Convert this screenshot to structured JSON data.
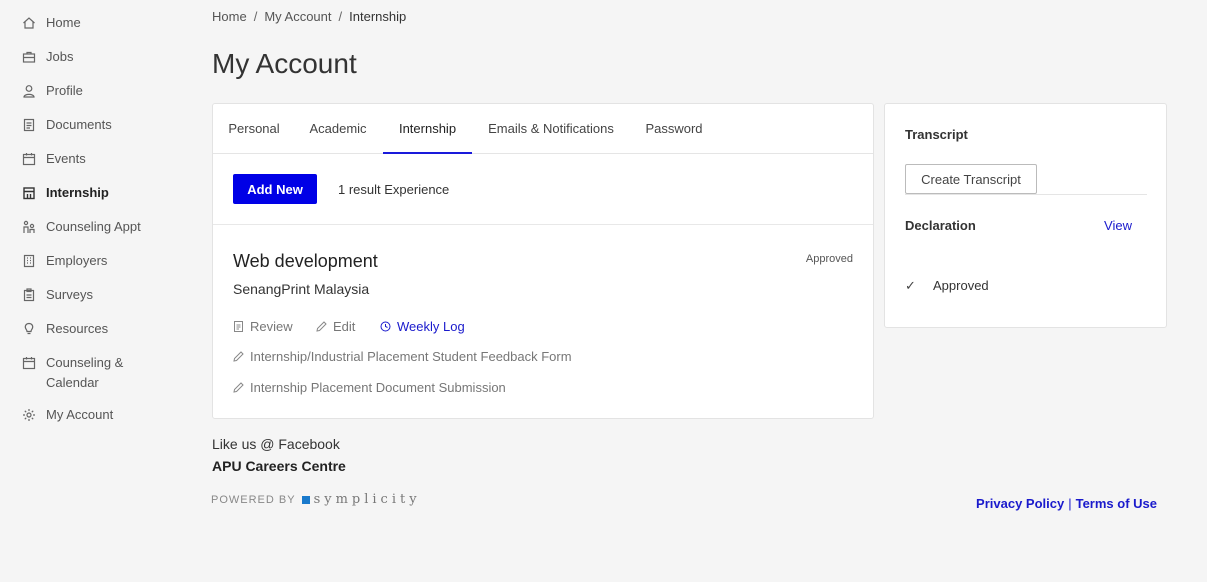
{
  "sidebar": {
    "items": [
      {
        "label": "Home",
        "icon": "home-icon"
      },
      {
        "label": "Jobs",
        "icon": "briefcase-icon"
      },
      {
        "label": "Profile",
        "icon": "user-icon"
      },
      {
        "label": "Documents",
        "icon": "document-icon"
      },
      {
        "label": "Events",
        "icon": "calendar-icon"
      },
      {
        "label": "Internship",
        "icon": "building-icon"
      },
      {
        "label": "Counseling Appt",
        "icon": "counseling-icon"
      },
      {
        "label": "Employers",
        "icon": "office-icon"
      },
      {
        "label": "Surveys",
        "icon": "clipboard-icon"
      },
      {
        "label": "Resources",
        "icon": "lightbulb-icon"
      },
      {
        "label": "Counseling & Calendar",
        "icon": "calendar-icon"
      },
      {
        "label": "My Account",
        "icon": "gear-icon"
      }
    ],
    "active": "Internship"
  },
  "breadcrumb": {
    "items": [
      "Home",
      "My Account",
      "Internship"
    ],
    "separator": "/"
  },
  "page": {
    "title": "My Account"
  },
  "tabs": {
    "items": [
      "Personal",
      "Academic",
      "Internship",
      "Emails & Notifications",
      "Password"
    ],
    "active": "Internship"
  },
  "main": {
    "add_button": "Add New",
    "result_text": "1 result Experience",
    "experience": {
      "title": "Web development",
      "company": "SenangPrint Malaysia",
      "status": "Approved",
      "actions": {
        "review": "Review",
        "edit": "Edit",
        "weekly_log": "Weekly Log",
        "feedback_form": "Internship/Industrial Placement Student Feedback Form",
        "doc_submission": "Internship Placement Document Submission"
      }
    }
  },
  "side": {
    "transcript_label": "Transcript",
    "create_button": "Create Transcript",
    "declaration_label": "Declaration",
    "view_link": "View",
    "approved_text": "Approved",
    "check_glyph": "✓"
  },
  "footer": {
    "facebook": "Like us @ Facebook",
    "centre": "APU Careers Centre",
    "powered_by": "POWERED BY",
    "brand": "symplicity",
    "privacy": "Privacy Policy",
    "separator": "|",
    "terms": "Terms of Use"
  },
  "colors": {
    "accent": "#0000e6",
    "link": "#1a1acc",
    "background": "#f5f5f5"
  }
}
